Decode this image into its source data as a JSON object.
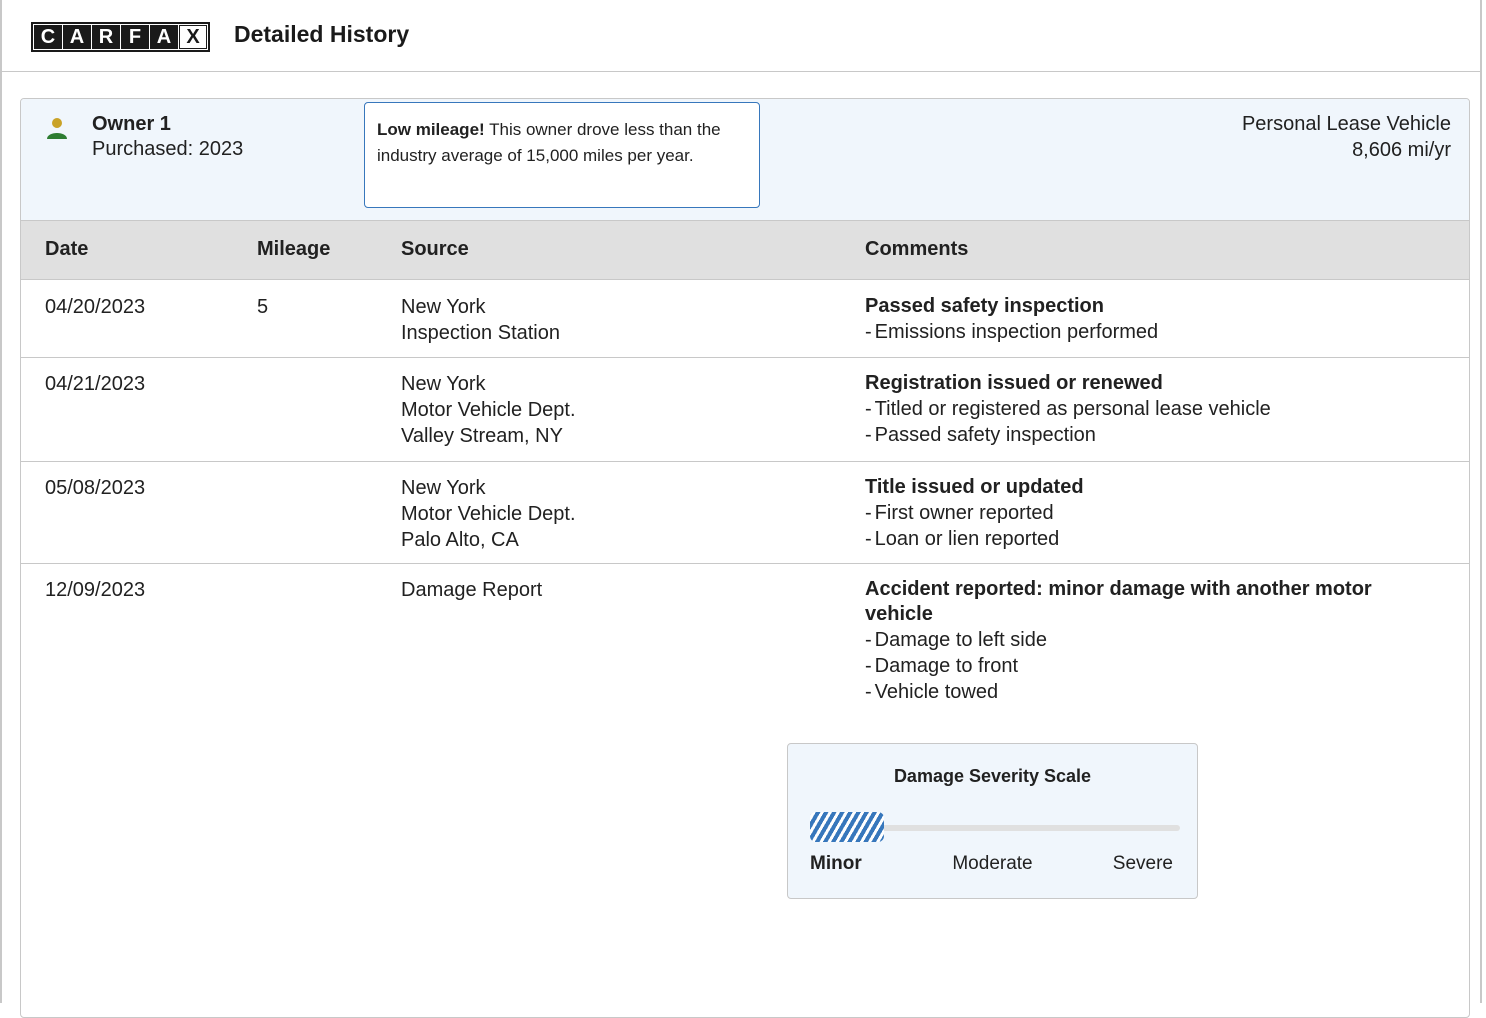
{
  "header": {
    "logo_letters": [
      "C",
      "A",
      "R",
      "F",
      "A",
      "X"
    ],
    "title": "Detailed History"
  },
  "owner": {
    "name": "Owner 1",
    "purchased": "Purchased: 2023",
    "callout_bold": "Low mileage!",
    "callout_text": " This owner drove less than the industry average of 15,000 miles per year.",
    "vehicle_type": "Personal Lease Vehicle",
    "mileage_rate": "8,606 mi/yr",
    "icon_colors": {
      "head": "#c9a227",
      "body": "#2e7d32"
    }
  },
  "table": {
    "headers": {
      "date": "Date",
      "mileage": "Mileage",
      "source": "Source",
      "comments": "Comments"
    },
    "rows": [
      {
        "date": "04/20/2023",
        "mileage": "5",
        "source": [
          "New York",
          "Inspection Station"
        ],
        "comment_title": "Passed safety inspection",
        "comment_details": [
          "Emissions inspection performed"
        ]
      },
      {
        "date": "04/21/2023",
        "mileage": "",
        "source": [
          "New York",
          "Motor Vehicle Dept.",
          "Valley Stream, NY"
        ],
        "comment_title": "Registration issued or renewed",
        "comment_details": [
          "Titled or registered as personal lease vehicle",
          "Passed safety inspection"
        ]
      },
      {
        "date": "05/08/2023",
        "mileage": "",
        "source": [
          "New York",
          "Motor Vehicle Dept.",
          "Palo Alto, CA"
        ],
        "comment_title": "Title issued or updated",
        "comment_details": [
          "First owner reported",
          "Loan or lien reported"
        ]
      },
      {
        "date": "12/09/2023",
        "mileage": "",
        "source": [
          "Damage Report"
        ],
        "comment_title": "Accident reported: minor damage with another motor vehicle",
        "comment_details": [
          "Damage to left side",
          "Damage to front",
          "Vehicle towed"
        ]
      }
    ]
  },
  "severity": {
    "title": "Damage Severity Scale",
    "labels": {
      "minor": "Minor",
      "moderate": "Moderate",
      "severe": "Severe"
    },
    "selected": "Minor",
    "accent_color": "#3777bc"
  }
}
